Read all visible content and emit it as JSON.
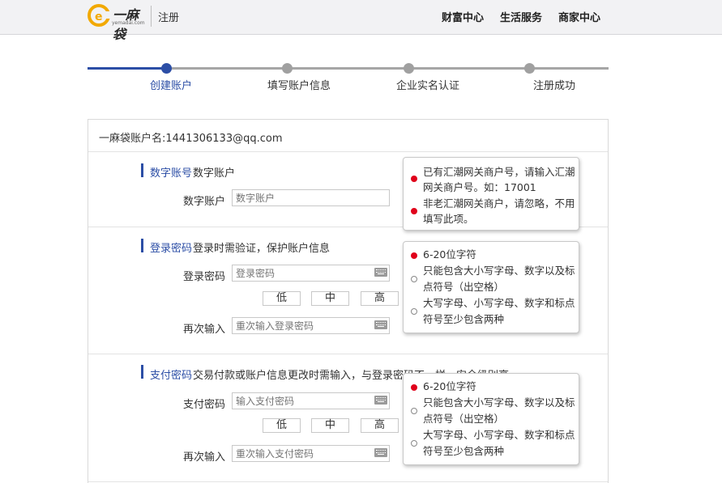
{
  "header": {
    "logo_text": "一麻袋",
    "logo_sub": "yemadai.com",
    "page_name": "注册",
    "nav": [
      "财富中心",
      "生活服务",
      "商家中心"
    ]
  },
  "steps": [
    {
      "label": "创建账户",
      "active": true
    },
    {
      "label": "填写账户信息",
      "active": false
    },
    {
      "label": "企业实名认证",
      "active": false
    },
    {
      "label": "注册成功",
      "active": false
    }
  ],
  "account": {
    "label": "一麻袋账户名:",
    "value": "1441306133@qq.com"
  },
  "digital_section": {
    "title": "数字账号",
    "desc": "数字账户",
    "field_label": "数字账户",
    "placeholder": "数字账户"
  },
  "login_section": {
    "title": "登录密码",
    "desc": "登录时需验证，保护账户信息",
    "field_label": "登录密码",
    "placeholder": "登录密码",
    "confirm_label": "再次输入",
    "confirm_placeholder": "重次输入登录密码",
    "strength": [
      "低",
      "中",
      "高"
    ]
  },
  "pay_section": {
    "title": "支付密码",
    "desc": "交易付款或账户信息更改时需输入，与登录密码不一样，安全级别高",
    "field_label": "支付密码",
    "placeholder": "输入支付密码",
    "confirm_label": "再次输入",
    "confirm_placeholder": "重次输入支付密码",
    "strength": [
      "低",
      "中",
      "高"
    ]
  },
  "tip_digital": [
    {
      "text": "已有汇潮网关商户号，请输入汇潮",
      "dot": "filled"
    },
    {
      "text": "网关商户号。如：17001",
      "dot": "none"
    },
    {
      "text": "非老汇潮网关商户，请忽略，不用",
      "dot": "filled"
    },
    {
      "text": "填写此项。",
      "dot": "none"
    }
  ],
  "tip_login": [
    {
      "text": "6-20位字符",
      "dot": "filled"
    },
    {
      "text": "只能包含大小写字母、数字以及标",
      "dot": "empty"
    },
    {
      "text": "点符号（出空格）",
      "dot": "none"
    },
    {
      "text": "大写字母、小写字母、数字和标点",
      "dot": "empty"
    },
    {
      "text": "符号至少包含两种",
      "dot": "none"
    }
  ],
  "tip_pay": [
    {
      "text": "6-20位字符",
      "dot": "filled"
    },
    {
      "text": "只能包含大小写字母、数字以及标",
      "dot": "empty"
    },
    {
      "text": "点符号（出空格）",
      "dot": "none"
    },
    {
      "text": "大写字母、小写字母、数字和标点",
      "dot": "empty"
    },
    {
      "text": "符号至少包含两种",
      "dot": "none"
    }
  ],
  "colors": {
    "accent": "#2c4ea6",
    "bullet_red": "#e0001b",
    "header_bg": "#f2f2f4"
  }
}
